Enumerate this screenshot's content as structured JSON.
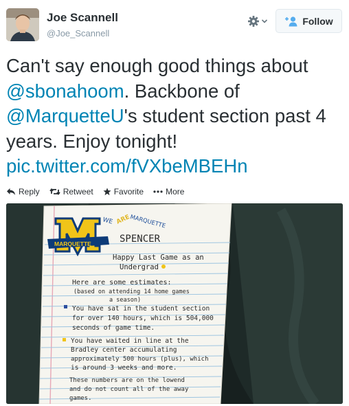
{
  "user": {
    "name": "Joe Scannell",
    "handle": "@Joe_Scannell"
  },
  "header": {
    "follow_label": "Follow"
  },
  "tweet": {
    "text_1": "Can't say enough good things about",
    "mention_1": "@sbonahoom",
    "text_2": ". Backbone of",
    "mention_2": "@MarquetteU",
    "text_3": "'s student section past 4 years. Enjoy tonight!",
    "link": "pic.twitter.com/fVXbeMBEHn"
  },
  "actions": {
    "reply": "Reply",
    "retweet": "Retweet",
    "favorite": "Favorite",
    "more": "More"
  },
  "note": {
    "corner_text_we": "WE",
    "corner_text_are": "ARE",
    "corner_text_marquette": "MARQUETTE",
    "banner": "MARQUETTE",
    "name": "SPENCER",
    "line_1": "Happy Last Game as an",
    "line_2": "Undergrad",
    "estimates": "Here are some estimates:",
    "basis_1": "(based on attending 14 home games",
    "basis_2": "a season)",
    "p1_1": "You have sat in the student section",
    "p1_2": "for over 140 hours, which is 504,000",
    "p1_3": "seconds of game time.",
    "p2_1": "You have waited in line at the",
    "p2_2": "Bradley center accumulating",
    "p2_3": "approximately 500 hours (plus), which",
    "p2_4": "is around 3 weeks and more.",
    "p3_1": "These numbers are on the lowend",
    "p3_2": "and do not count all of the away",
    "p3_3": "games."
  },
  "colors": {
    "link": "#0084b4",
    "text": "#292f33",
    "secondary": "#8899a6",
    "marquette_gold": "#f0c419",
    "marquette_blue": "#0d3b78"
  }
}
